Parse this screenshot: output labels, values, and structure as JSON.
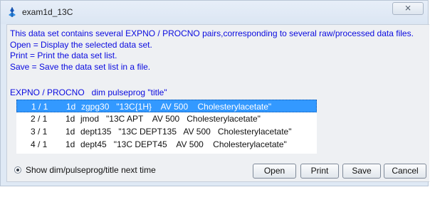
{
  "window": {
    "title": "exam1d_13C",
    "close_glyph": "⨯"
  },
  "info": {
    "lines": [
      "This data set contains several EXPNO / PROCNO pairs,corresponding to several raw/processed data files.",
      "Open = Display the selected data set.",
      "Print = Print the data set list.",
      "Save = Save the data set list in a file."
    ]
  },
  "list": {
    "header": "EXPNO / PROCNO   dim pulseprog \"title\"",
    "rows": [
      {
        "expno": "1 / 1",
        "dim": "1d",
        "rest": "zgpg30   \"13C{1H}    AV 500    Cholesterylacetate\"",
        "selected": true
      },
      {
        "expno": "2 / 1",
        "dim": "1d",
        "rest": "jmod   \"13C APT    AV 500   Cholesterylacetate\"",
        "selected": false
      },
      {
        "expno": "3 / 1",
        "dim": "1d",
        "rest": "dept135   \"13C DEPT135   AV 500   Cholesterylacetate\"",
        "selected": false
      },
      {
        "expno": "4 / 1",
        "dim": "1d",
        "rest": "dept45   \"13C DEPT45    AV 500    Cholesterylacetate\"",
        "selected": false
      }
    ]
  },
  "footer": {
    "radio_label": "Show dim/pulseprog/title next time",
    "radio_checked": true,
    "buttons": {
      "open": "Open",
      "print": "Print",
      "save": "Save",
      "cancel": "Cancel"
    }
  },
  "colors": {
    "info_text": "#0a0adf",
    "selection": "#3399ff",
    "title_bar": "#dfe9f5",
    "content_bg": "#eef0f3"
  },
  "icons": {
    "title": "topspin-app-icon",
    "close": "close-icon"
  }
}
